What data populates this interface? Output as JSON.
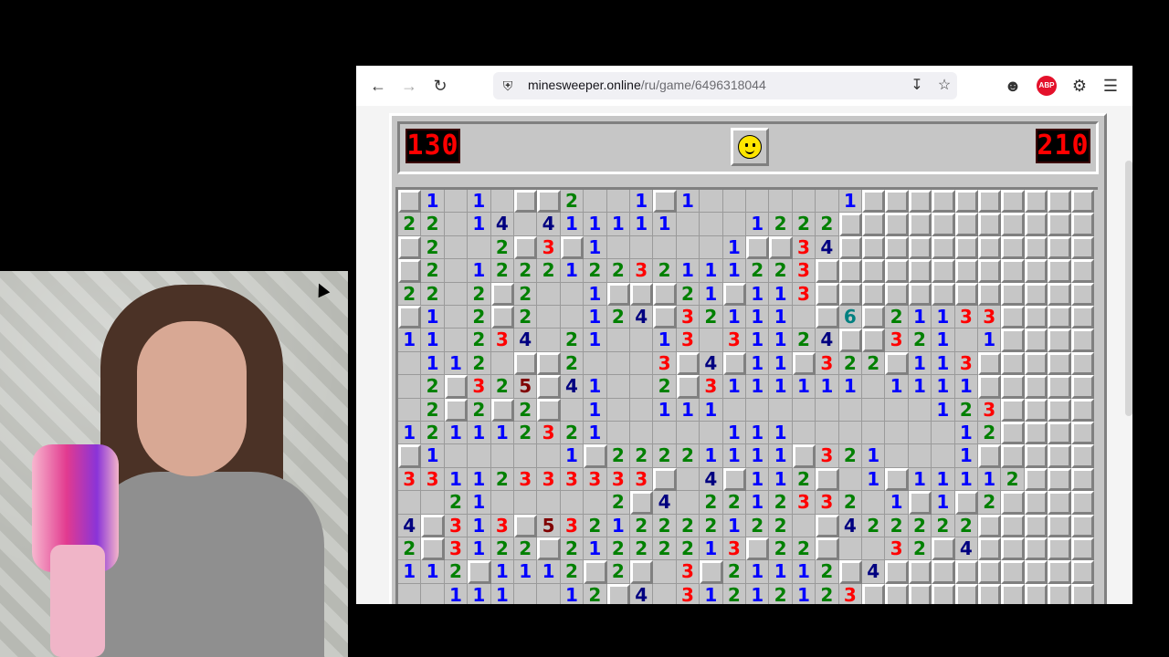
{
  "browser": {
    "url_host": "minesweeper.online",
    "url_path": "/ru/game/6496318044",
    "icons": [
      "back-arrow-icon",
      "forward-arrow-icon",
      "reload-icon",
      "shield-icon",
      "download-icon",
      "star-icon",
      "account-icon",
      "adblock-icon",
      "extensions-icon",
      "menu-icon"
    ],
    "adblock_label": "ABP"
  },
  "game": {
    "mines_left": "130",
    "timer": "210",
    "smiley": "smiley-face-icon",
    "columns": 30,
    "rows": [
      "c1.1.cc2..1c1......1cccccccccc",
      "22.14.411111...1222cccccccccccc",
      "c2..2c3c1.....1cc34ccccccccccc",
      "c2.122212232111223cccccccccccc",
      "22.2c2..1ccc21c113cccccccccccc",
      "c1.2c2..124c32111.c6c21133cccc",
      "11.234.21..13.31124cc321.1cccc",
      ".112.cc2...3c4c11c322c113cccccc",
      ".2c325c41..2c3111111.1111ccccc",
      ".2c2c2c.1..111.........123cccc",
      "121112321.....111.......12cccc",
      "c1.....1c22221111c321...1ccccc",
      "33112333333c.4c112c.1c11112cccc",
      "..21.....2c4.2212332.1c1c2cccc",
      "4c313c53212222122.c422222ccccc",
      "2c3122c21222213c22c..32c4ccccc",
      "112c1112c2c.3c21112c4ccccccccc",
      "..111..12c4.31212123cccccccccc"
    ]
  }
}
